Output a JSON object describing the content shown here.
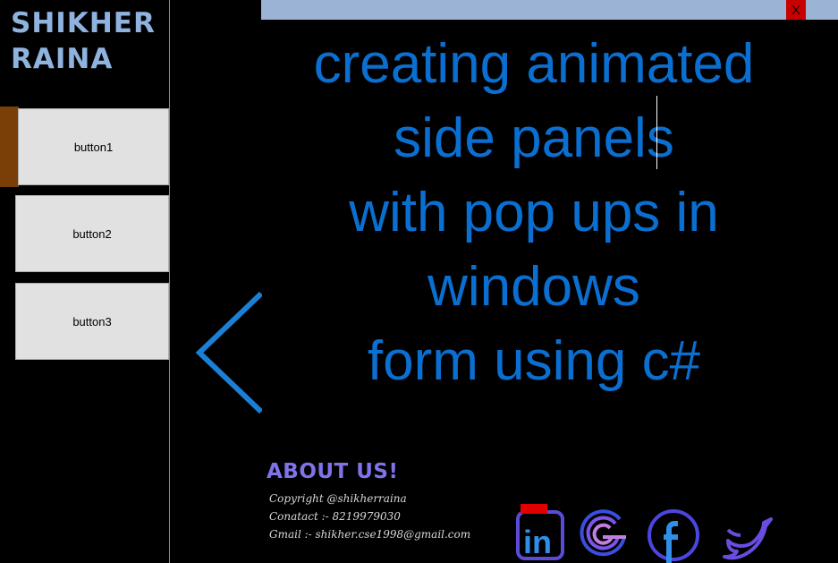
{
  "sidebar": {
    "brand_line1": "SHIKHER",
    "brand_line2": "RAINA",
    "buttons": [
      {
        "label": "button1"
      },
      {
        "label": "button2"
      },
      {
        "label": "button3"
      }
    ]
  },
  "titlebar": {
    "close_label": "X"
  },
  "headline": {
    "lines": [
      "creating  animated",
      "side panels",
      "with  pop ups  in",
      "windows",
      "form  using  c#"
    ]
  },
  "about": {
    "title": "ABOUT US!",
    "copyright": "Copyright @shikherraina",
    "contact": "Conatact :- 8219979030",
    "gmail": "Gmail :- shikher.cse1998@gmail.com"
  },
  "social": {
    "icons": [
      "linkedin-icon",
      "google-icon",
      "facebook-icon",
      "twitter-icon"
    ],
    "linkedin_text": "in"
  },
  "colors": {
    "headline": "#0a6fd0",
    "topbar": "#9bb4d6",
    "close": "#c80000",
    "active_indicator": "#7a3f06",
    "arrow": "#1b7fd6",
    "about_title": "#7f73e8"
  }
}
